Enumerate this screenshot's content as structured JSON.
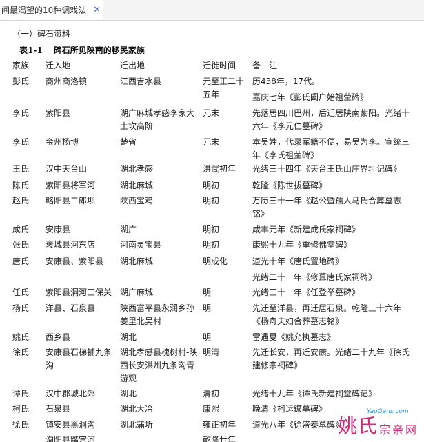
{
  "tab": {
    "title": "间最渴望的10种调戏法",
    "close_glyph": "✕"
  },
  "section_heading": "（一）碑石资料",
  "table": {
    "number": "表1-1",
    "title": "碑石所见陕南的移民家族",
    "headers": [
      "家族",
      "迁入地",
      "迁出地",
      "迁徙时间",
      "备　注"
    ],
    "rows": [
      [
        "彭氏",
        "商州商洛镇",
        "江西吉水县",
        "元至正二十五年",
        "历438年，17代。"
      ],
      [
        "",
        "",
        "",
        "",
        "嘉庆七年《彭氏阖户始祖茔碑》"
      ],
      [
        "李氏",
        "紫阳县",
        "湖广麻城孝感李家大土坎高阶",
        "元末",
        "先落居四川巴州，后迁居陕南紫阳。光绪十六年《李元仁墓碑》"
      ],
      [
        "李氏",
        "金州杨博",
        "楚省",
        "元末",
        "本吴姓，代录军籍不便，易吴为李。宣统三年《李氏祖茔碑》"
      ],
      [
        "王氏",
        "汉中天台山",
        "湖北孝感",
        "洪武初年",
        "光绪三十四年《天台王氏山庄界址记碑》"
      ],
      [
        "陈氏",
        "紫阳县将军河",
        "湖北麻城",
        "明初",
        "乾隆《陈世拔墓碑》"
      ],
      [
        "赵氏",
        "略阳县二郎坝",
        "陕西宝鸡",
        "明初",
        "万历三十一年《赵公暨孺人马氏合葬墓志铭》"
      ],
      [
        "成氏",
        "安康县",
        "湖广",
        "明初",
        "咸丰元年《新建成氏家祠碑》"
      ],
      [
        "张氏",
        "褒城县河东店",
        "河南灵宝县",
        "明初",
        "康熙十九年《重修佛堂碑》"
      ],
      [
        "唐氏",
        "安康县、紫阳县",
        "湖北麻城",
        "明成化",
        "道光十年《唐氏置地碑》"
      ],
      [
        "",
        "",
        "",
        "",
        "光绪二十一年《修葺唐氏家祠碑》"
      ],
      [
        "任氏",
        "紫阳县洞河三保关",
        "湖广麻城",
        "明",
        "光绪三十一年《任登举墓碑》"
      ],
      [
        "杨氏",
        "洋县、石泉县",
        "陕西富平县永润乡孙姜里北吴村",
        "明",
        "先迁至洋县，再迁居石泉。乾隆三十六年《杨舟夫妇合葬墓志铭》"
      ],
      [
        "姚氏",
        "西乡县",
        "湖北",
        "明",
        "雷遇夏《姚允执墓志》"
      ],
      [
        "徐氏",
        "安康县石梯铺九条沟",
        "湖北孝感县槐树村-陕西长安洪州九条沟青游观",
        "明清",
        "先迁长安，再迁安康。光绪二十九年《徐氏建修宗祠碑》"
      ],
      [
        "谭氏",
        "汉中郡城北郊",
        "湖北",
        "清初",
        "光绪十九年《谭氏新建祠堂碑记》"
      ],
      [
        "柯氏",
        "石泉县",
        "湖北大冶",
        "康熙",
        "晚清《柯运鑛墓碑》"
      ],
      [
        "徐氏",
        "镇安县黑洞沟",
        "湖北蒲圻",
        "雍正初年",
        "道光八年《徐盛泰墓碑》"
      ],
      [
        "",
        "洵阳县踏宫河",
        "",
        "乾隆廿年",
        ""
      ]
    ]
  },
  "watermark": {
    "main": "姚氏",
    "sub": "宗亲网",
    "url": "YaoGens.com"
  },
  "colors": {
    "watermark": "#d9287a",
    "watermark_url": "#2f8fd8",
    "close_icon": "#3a6ad4"
  }
}
